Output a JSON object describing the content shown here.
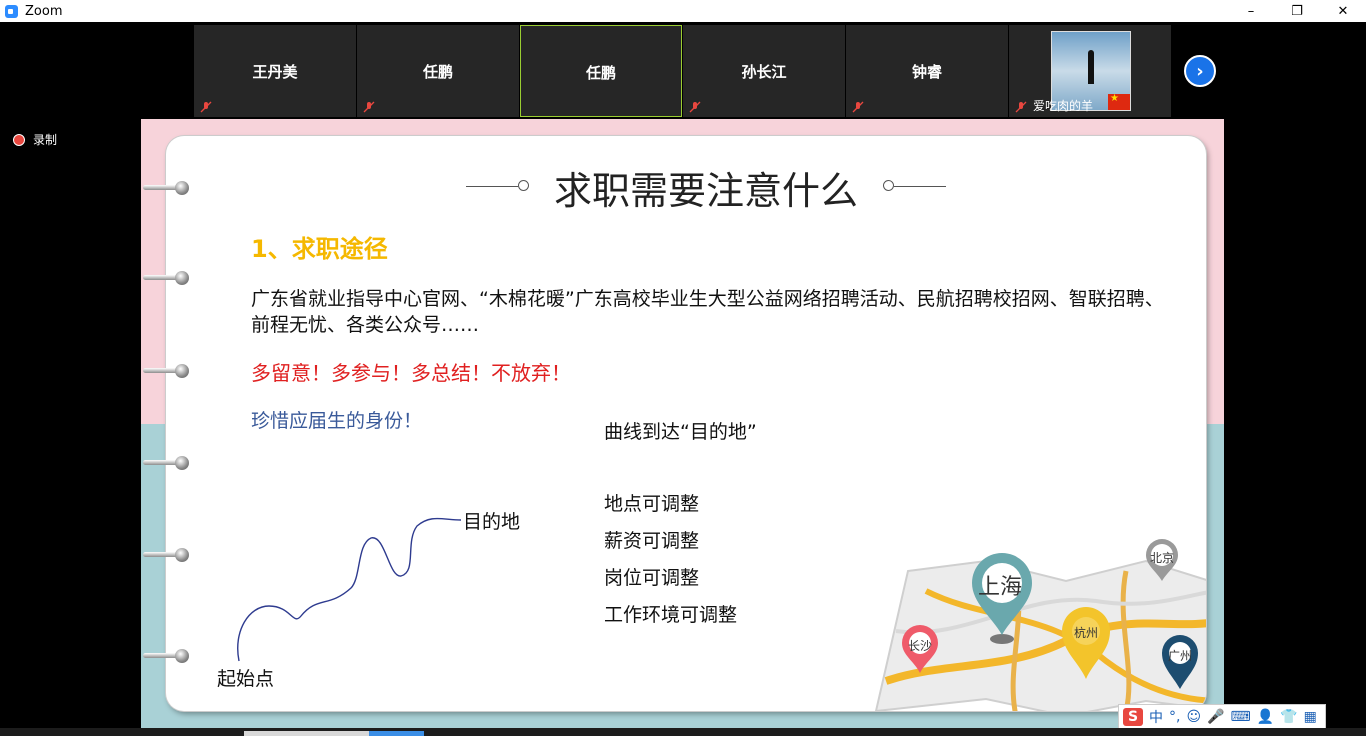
{
  "window": {
    "title": "Zoom",
    "min": "–",
    "max": "❐",
    "close": "✕"
  },
  "participants": [
    {
      "name": "王丹美"
    },
    {
      "name": "任鹏"
    },
    {
      "name": "任鹏",
      "active": true
    },
    {
      "name": "孙长江"
    },
    {
      "name": "钟睿"
    },
    {
      "name": "爱吃肉的羊"
    }
  ],
  "next_icon": "›",
  "recording": {
    "label": "录制"
  },
  "slide": {
    "title": "求职需要注意什么",
    "section": "1、求职途径",
    "paragraph": "广东省就业指导中心官网、“木棉花暖”广东高校毕业生大型公益网络招聘活动、民航招聘校招网、智联招聘、前程无忧、各类公众号……",
    "slogan": "多留意！多参与！多总结！不放弃！",
    "cherish": "珍惜应届生的身份！",
    "curve_title": "曲线到达“目的地”",
    "adjust": [
      "地点可调整",
      "薪资可调整",
      "岗位可调整",
      "工作环境可调整"
    ],
    "destination": "目的地",
    "start": "起始点",
    "map_labels": {
      "shanghai": "上海",
      "beijing": "北京",
      "hangzhou": "杭州",
      "changsha": "长沙",
      "guangzhou": "广州"
    }
  },
  "ime": {
    "logo": "S",
    "mode": "中",
    "punct": "°,",
    "icons": [
      "☺",
      "🎤",
      "⌨",
      "👤",
      "👕",
      "▦"
    ]
  },
  "colors": {
    "accent_yellow": "#f5b800",
    "slogan_red": "#e02020",
    "cherish_blue": "#3a5a9a",
    "active_border": "#9acd32",
    "pink": "#f7d3da",
    "teal": "#a9d1d6"
  }
}
